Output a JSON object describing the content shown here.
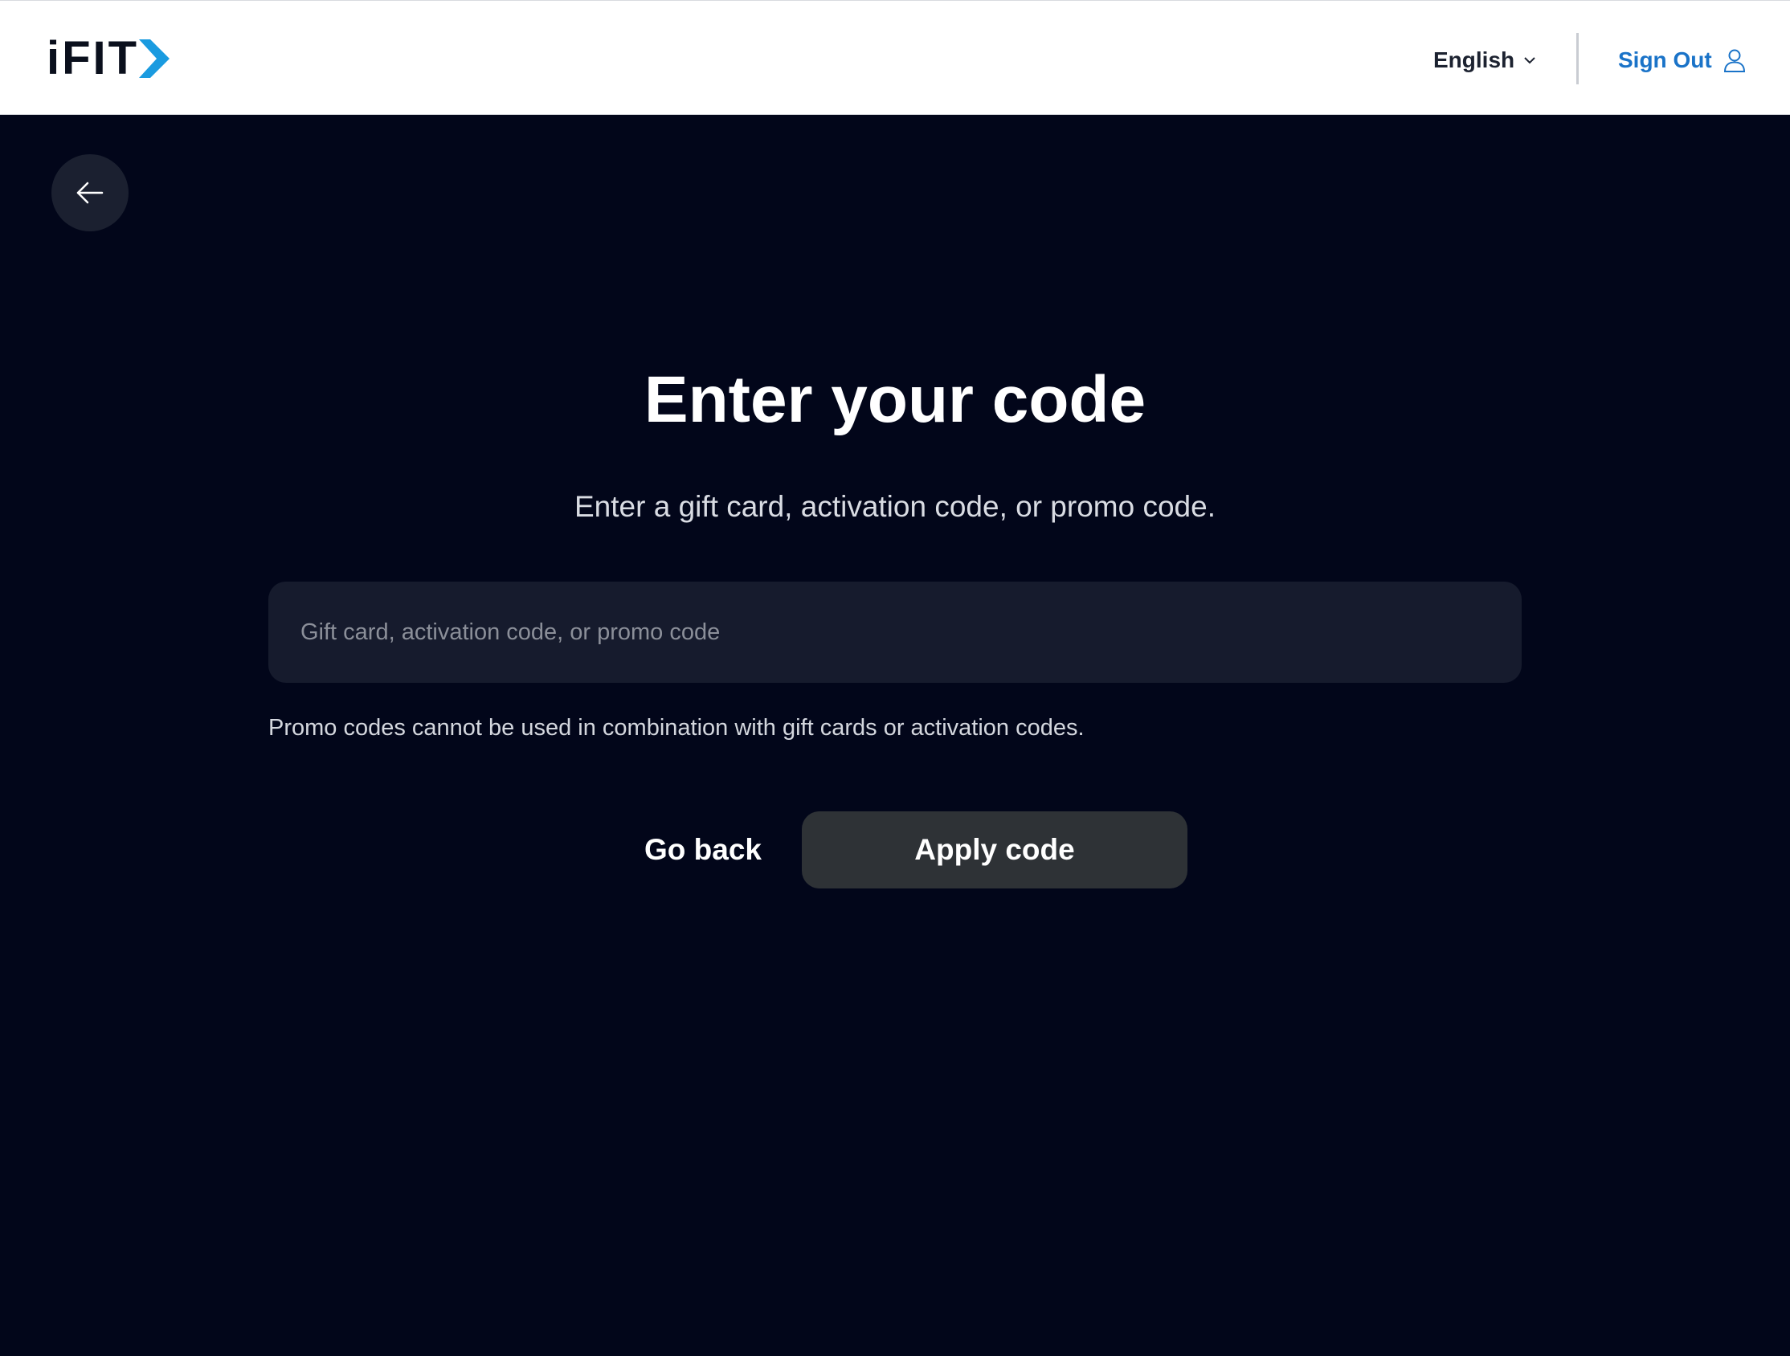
{
  "header": {
    "logo_text": "iFIT",
    "logo_icon": "chevron-right-icon",
    "language": {
      "selected": "English",
      "icon": "chevron-down-icon"
    },
    "sign_out_label": "Sign Out",
    "sign_out_icon": "user-icon"
  },
  "nav": {
    "back_icon": "arrow-left-icon"
  },
  "main": {
    "title": "Enter your code",
    "subtitle": "Enter a gift card, activation code, or promo code.",
    "code_input": {
      "value": "",
      "placeholder": "Gift card, activation code, or promo code"
    },
    "note": "Promo codes cannot be used in combination with gift cards or activation codes.",
    "go_back_label": "Go back",
    "apply_label": "Apply code"
  },
  "colors": {
    "page_background": "#02061a",
    "header_background": "#ffffff",
    "accent_blue": "#1a73c8",
    "logo_chevron_blue": "#1a9be0",
    "input_background": "#161b2d",
    "apply_button_background": "#2e3236"
  }
}
